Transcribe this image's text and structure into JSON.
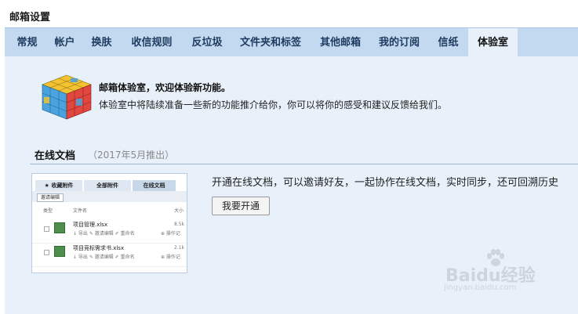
{
  "page_title": "邮箱设置",
  "tabs": [
    {
      "label": "常规"
    },
    {
      "label": "帐户"
    },
    {
      "label": "换肤"
    },
    {
      "label": "收信规则"
    },
    {
      "label": "反垃圾"
    },
    {
      "label": "文件夹和标签"
    },
    {
      "label": "其他邮箱"
    },
    {
      "label": "我的订阅"
    },
    {
      "label": "信纸"
    },
    {
      "label": "体验室",
      "active": true
    }
  ],
  "intro": {
    "headline": "邮箱体验室，欢迎体验新功能。",
    "text": "体验室中将陆续准备一些新的功能推介给你，你可以将你的感受和建议反馈给我们。",
    "icon": "rubik-cube-icon"
  },
  "feature": {
    "title": "在线文档",
    "subtitle": "（2017年5月推出）",
    "description": "开通在线文档，可以邀请好友，一起协作在线文档，实时同步，还可回溯历史",
    "button_label": "我要开通",
    "preview": {
      "tabs": [
        "★ 收藏附件",
        "全部附件",
        "在线文档"
      ],
      "active_tab": "在线文档",
      "toolbar_button": "邀请编辑",
      "columns": [
        "类型",
        "文件名",
        "大小"
      ],
      "files": [
        {
          "name": "项目管理.xlsx",
          "size": "8.5k",
          "actions": "↓ 导出   ✎ 邀请编辑   ✐ 重命名",
          "log": "⊕ 操作记"
        },
        {
          "name": "项目竞标需求书.xlsx",
          "size": "2.1k",
          "actions": "↓ 导出   ✎ 邀请编辑   ✐ 重命名",
          "log": "⊕ 操作记"
        }
      ]
    }
  },
  "watermark": {
    "brand": "Baidu经验",
    "url": "jingyan.baidu.com"
  }
}
